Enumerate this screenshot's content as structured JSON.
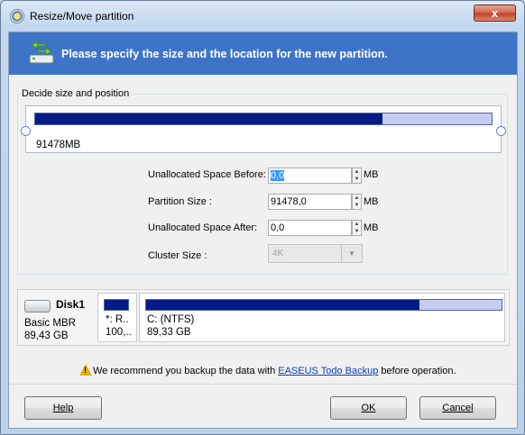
{
  "window": {
    "title": "Resize/Move partition",
    "close_symbol": "x"
  },
  "banner": {
    "text": "Please specify the size and the location for the new partition."
  },
  "group": {
    "legend": "Decide size and position",
    "bar_size": "91478MB",
    "bar_fill_fraction": 0.76
  },
  "form": {
    "before_label": "Unallocated Space Before:",
    "before_value": "0,0",
    "size_label": "Partition Size :",
    "size_value": "91478,0",
    "after_label": "Unallocated Space After:",
    "after_value": "0,0",
    "unit": "MB",
    "cluster_label": "Cluster Size :",
    "cluster_value": "4K"
  },
  "disk": {
    "name": "Disk1",
    "type": "Basic MBR",
    "size": "89,43 GB",
    "partitions": [
      {
        "line1": "*: R..",
        "line2": "100,..",
        "fill_fraction": 1.0
      },
      {
        "line1": "C: (NTFS)",
        "line2": "89,33 GB",
        "fill_fraction": 0.77
      }
    ]
  },
  "notice": {
    "before_link": "We recommend you backup the data with ",
    "link": "EASEUS Todo Backup",
    "after_link": " before operation."
  },
  "buttons": {
    "help": "Help",
    "ok": "OK",
    "cancel": "Cancel"
  },
  "colors": {
    "banner": "#3e74c8",
    "bar_fill": "#061b86",
    "bar_empty": "#c6cdf0",
    "selection": "#3399ff"
  }
}
